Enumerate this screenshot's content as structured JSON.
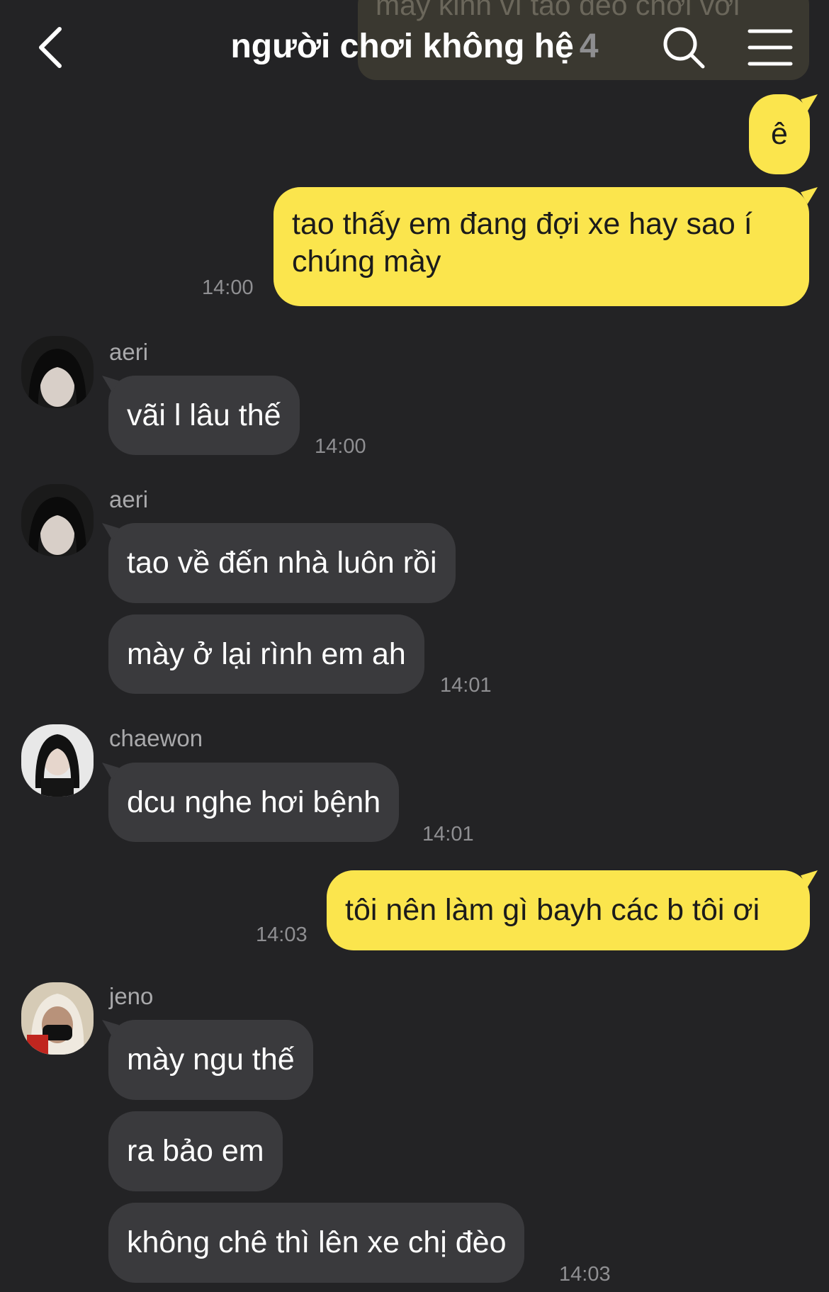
{
  "header": {
    "title": "người chơi không hệ",
    "member_count": "4",
    "back_icon": "chevron-left-icon",
    "search_icon": "search-icon",
    "menu_icon": "hamburger-menu-icon"
  },
  "ghost_message": "mày kinh vì tao đéo chơi với",
  "colors": {
    "background": "#232325",
    "my_bubble": "#fbe54d",
    "other_bubble": "#3a3a3d",
    "time_text": "#8f8f92"
  },
  "messages": {
    "m1": {
      "text": "ê"
    },
    "m2": {
      "text": "tao thấy em đang đợi xe hay sao í chúng mày",
      "time": "14:00"
    },
    "g1": {
      "sender": "aeri",
      "text": "vãi l lâu thế",
      "time": "14:00"
    },
    "g2": {
      "sender": "aeri",
      "text1": "tao về đến nhà luôn rồi",
      "text2": "mày ở lại rình em ah",
      "time": "14:01"
    },
    "g3": {
      "sender": "chaewon",
      "text": "dcu nghe hơi bệnh",
      "time": "14:01"
    },
    "m3": {
      "text": "tôi nên làm gì bayh các b tôi ơi",
      "time": "14:03"
    },
    "g4": {
      "sender": "jeno",
      "text1": "mày ngu thế",
      "text2": "ra bảo em",
      "text3": "không chê thì lên xe chị đèo",
      "time": "14:03"
    }
  }
}
